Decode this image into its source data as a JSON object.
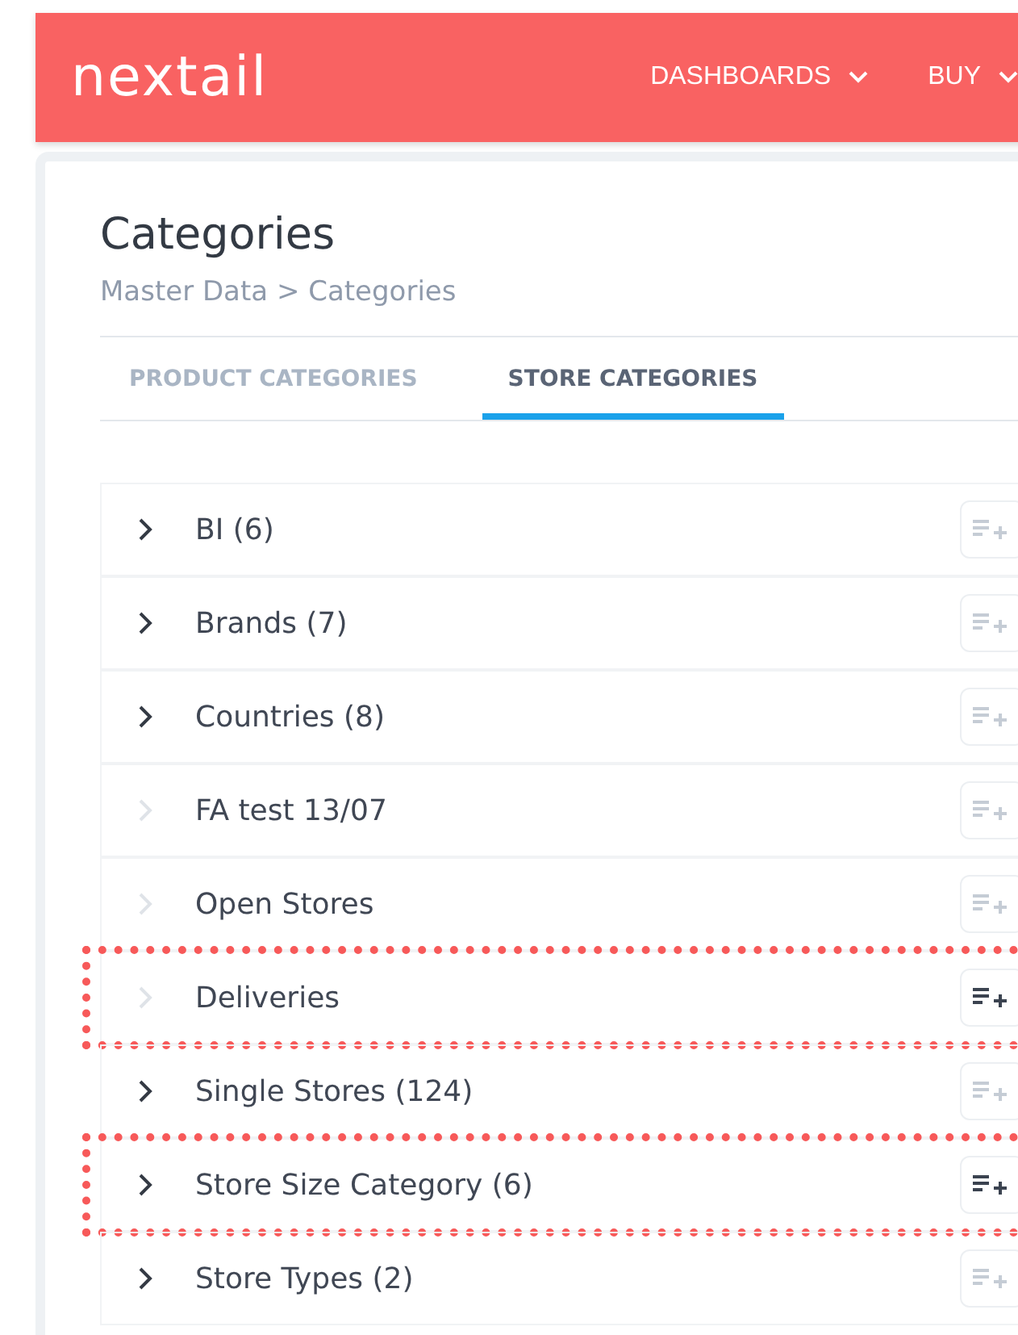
{
  "header": {
    "logo": "nextail",
    "menu": [
      {
        "label": "DASHBOARDS"
      },
      {
        "label": "BUY"
      }
    ]
  },
  "page": {
    "title": "Categories",
    "breadcrumb": "Master Data > Categories"
  },
  "tabs": [
    {
      "label": "PRODUCT CATEGORIES",
      "selected": false
    },
    {
      "label": "STORE CATEGORIES",
      "selected": true
    }
  ],
  "categories": [
    {
      "name": "BI (6)",
      "expandable": true,
      "highlighted": false
    },
    {
      "name": "Brands (7)",
      "expandable": true,
      "highlighted": false
    },
    {
      "name": "Countries (8)",
      "expandable": true,
      "highlighted": false
    },
    {
      "name": "FA test 13/07",
      "expandable": false,
      "highlighted": false
    },
    {
      "name": "Open Stores",
      "expandable": false,
      "highlighted": false
    },
    {
      "name": "Deliveries",
      "expandable": false,
      "highlighted": true
    },
    {
      "name": "Single Stores (124)",
      "expandable": true,
      "highlighted": false
    },
    {
      "name": "Store Size Category (6)",
      "expandable": true,
      "highlighted": true
    },
    {
      "name": "Store Types (2)",
      "expandable": true,
      "highlighted": false
    }
  ]
}
